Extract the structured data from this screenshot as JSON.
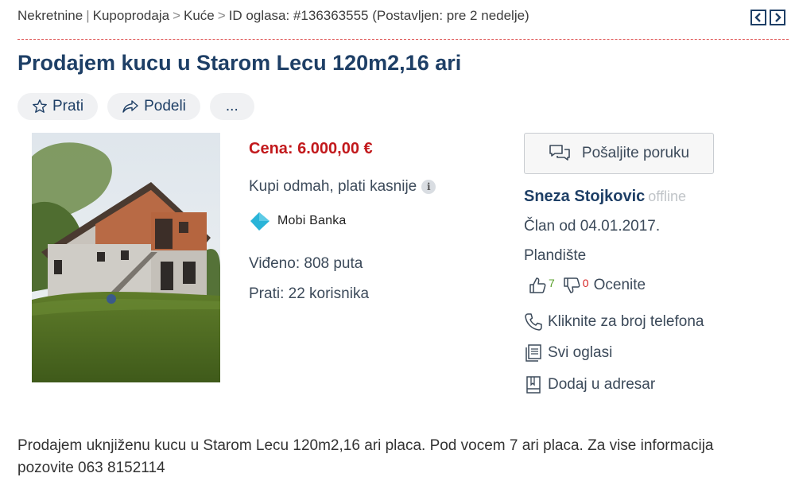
{
  "breadcrumb": {
    "items": [
      "Nekretnine",
      "Kupoprodaja",
      "Kuće"
    ],
    "separators": [
      "|",
      ">",
      ">"
    ],
    "id_text": "ID oglasa: #136363555 (Postavljen: pre 2 nedelje)"
  },
  "nav": {
    "prev_icon": "chevron-left-icon",
    "next_icon": "chevron-right-icon"
  },
  "title": "Prodajem kucu u Starom Lecu 120m2,16 ari",
  "actions": {
    "follow": "Prati",
    "share": "Podeli",
    "more": "..."
  },
  "listing": {
    "price": "Cena: 6.000,00 €",
    "buy_now": "Kupi odmah, plati kasnije",
    "info_icon": "i",
    "bank_name": "Mobi Banka",
    "views": "Viđeno: 808 puta",
    "followers": "Prati: 22 korisnika"
  },
  "seller": {
    "message_button": "Pošaljite poruku",
    "name": "Sneza Stojkovic",
    "status": "offline",
    "member_since": "Član od 04.01.2017.",
    "location": "Plandište",
    "positive_count": "7",
    "negative_count": "0",
    "rate_label": "Ocenite",
    "phone_link": "Kliknite za broj telefona",
    "all_ads_link": "Svi oglasi",
    "address_book_link": "Dodaj u adresar"
  },
  "description": "Prodajem uknjiženu kucu u Starom Lecu 120m2,16 ari placa. Pod vocem 7 ari placa. Za vise informacija pozovite 063 8152114",
  "colors": {
    "title": "#1e3f66",
    "price": "#c2191c",
    "positive": "#5aa02c",
    "negative": "#d62222",
    "divider": "#e05a5a",
    "mobi_logo": "#2ab4d8"
  }
}
